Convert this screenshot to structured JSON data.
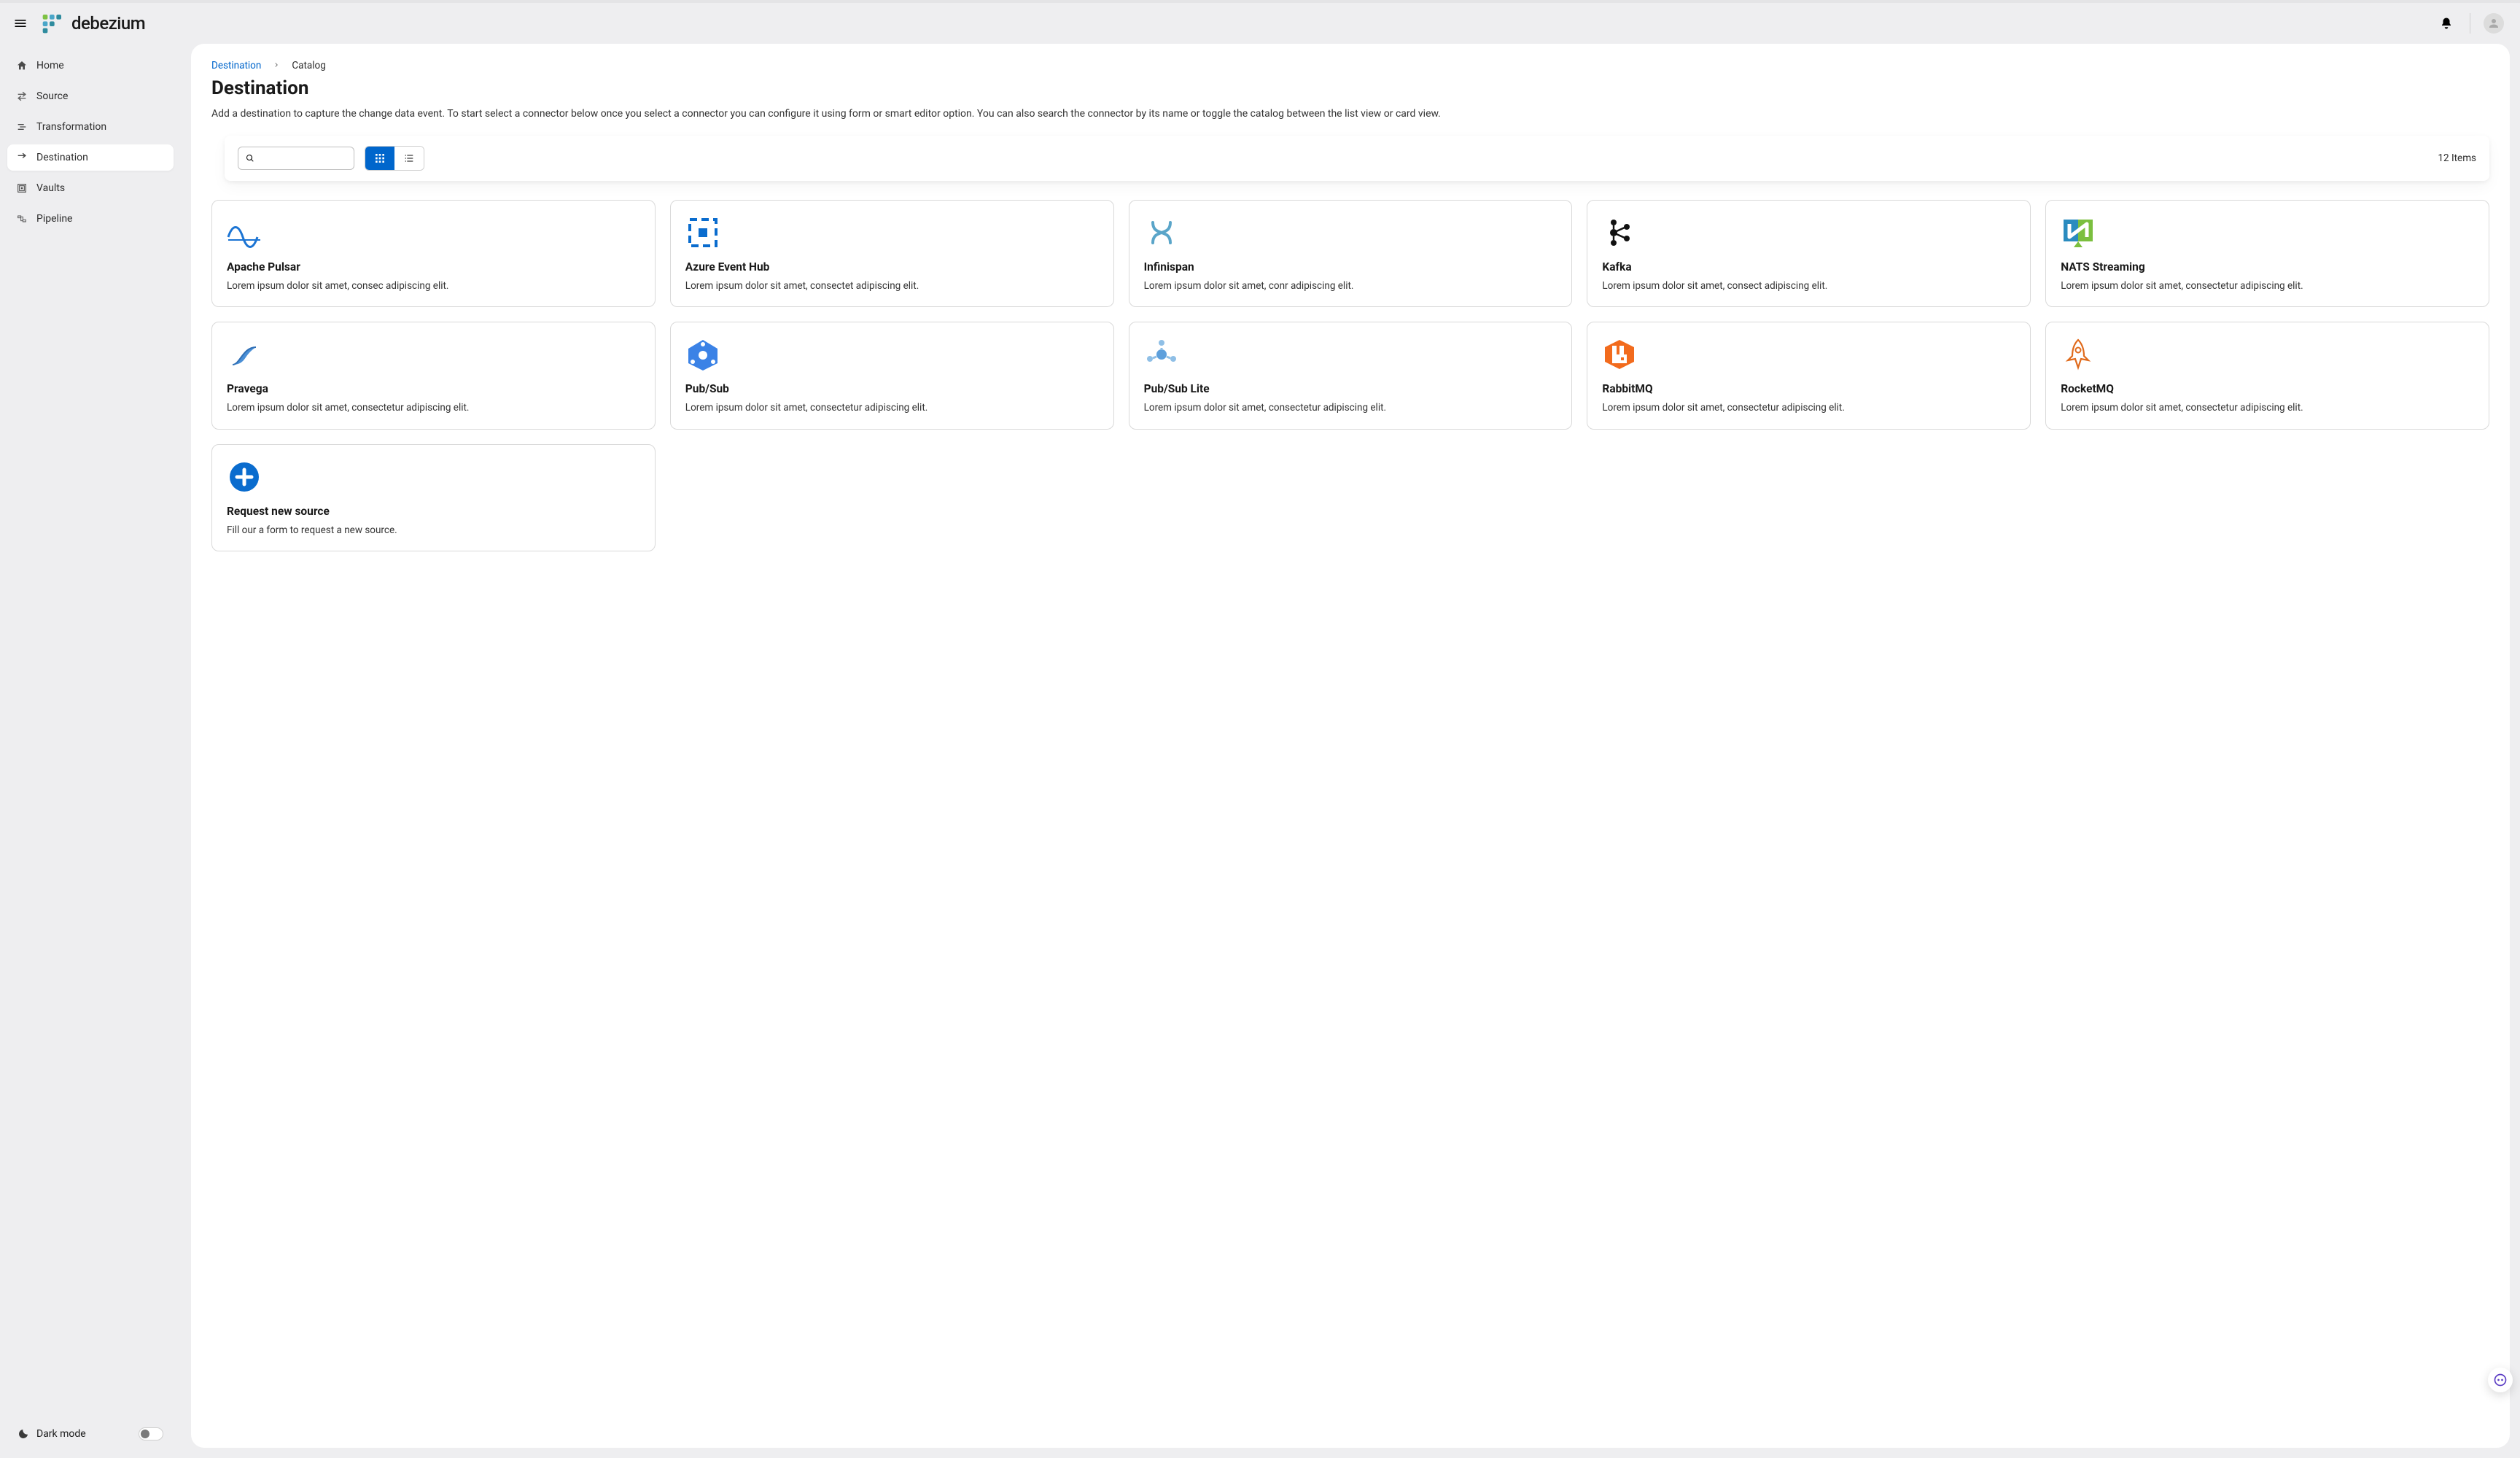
{
  "brand": {
    "name": "debezium"
  },
  "sidebar": {
    "items": [
      {
        "label": "Home",
        "icon": "home-icon"
      },
      {
        "label": "Source",
        "icon": "source-icon"
      },
      {
        "label": "Transformation",
        "icon": "transformation-icon"
      },
      {
        "label": "Destination",
        "icon": "destination-icon",
        "active": true
      },
      {
        "label": "Vaults",
        "icon": "vaults-icon"
      },
      {
        "label": "Pipeline",
        "icon": "pipeline-icon"
      }
    ],
    "dark_mode_label": "Dark mode",
    "dark_mode_on": false
  },
  "breadcrumb": {
    "parent": "Destination",
    "current": "Catalog"
  },
  "page": {
    "title": "Destination",
    "description": "Add a destination to capture the change data event. To start select a connector below once you select a connector you can configure it using form or smart editor option. You can also search the connector by its name or toggle the catalog between the list view or card view."
  },
  "toolbar": {
    "search_value": "",
    "search_placeholder": "",
    "view": "grid",
    "items_count_label": "12 Items"
  },
  "catalog": {
    "items": [
      {
        "id": "apache-pulsar",
        "title": "Apache Pulsar",
        "desc": "Lorem ipsum dolor sit amet, consec adipiscing elit."
      },
      {
        "id": "azure-event-hub",
        "title": "Azure Event Hub",
        "desc": "Lorem ipsum dolor sit amet, consectet adipiscing elit."
      },
      {
        "id": "infinispan",
        "title": "Infinispan",
        "desc": "Lorem ipsum dolor sit amet, conr adipiscing elit."
      },
      {
        "id": "kafka",
        "title": "Kafka",
        "desc": "Lorem ipsum dolor sit amet, consect adipiscing elit."
      },
      {
        "id": "nats-streaming",
        "title": "NATS Streaming",
        "desc": "Lorem ipsum dolor sit amet, consectetur adipiscing elit."
      },
      {
        "id": "pravega",
        "title": "Pravega",
        "desc": "Lorem ipsum dolor sit amet, consectetur adipiscing elit."
      },
      {
        "id": "pubsub",
        "title": "Pub/Sub",
        "desc": "Lorem ipsum dolor sit amet, consectetur adipiscing elit."
      },
      {
        "id": "pubsub-lite",
        "title": "Pub/Sub Lite",
        "desc": "Lorem ipsum dolor sit amet, consectetur adipiscing elit."
      },
      {
        "id": "rabbitmq",
        "title": "RabbitMQ",
        "desc": "Lorem ipsum dolor sit amet, consectetur adipiscing elit."
      },
      {
        "id": "rocketmq",
        "title": "RocketMQ",
        "desc": "Lorem ipsum dolor sit amet, consectetur adipiscing elit."
      }
    ],
    "request": {
      "title": "Request new source",
      "desc": "Fill our a form to request a new source."
    }
  }
}
